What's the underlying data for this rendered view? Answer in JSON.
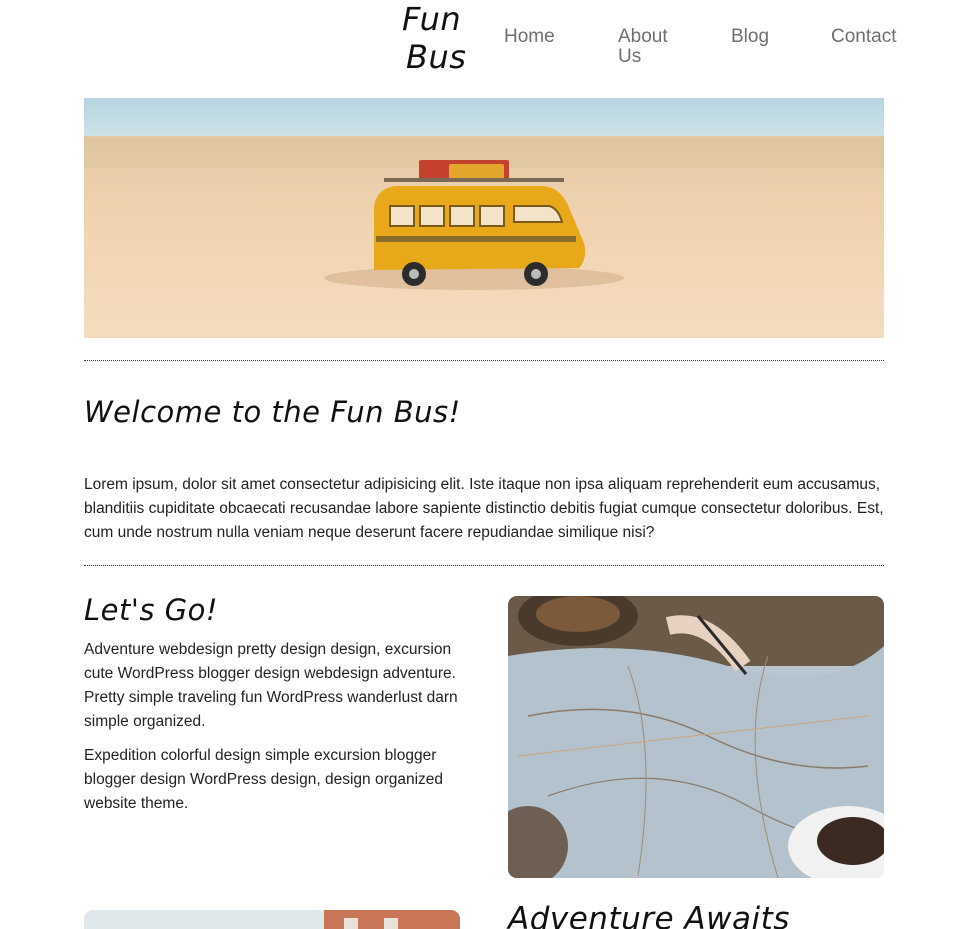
{
  "site": {
    "logo_line1": "Fun",
    "logo_line2": "Bus"
  },
  "nav": {
    "home": "Home",
    "about": "About Us",
    "blog": "Blog",
    "contact": "Contact"
  },
  "welcome": {
    "title": "Welcome to the Fun Bus!",
    "body": "Lorem ipsum, dolor sit amet consectetur adipisicing elit. Iste itaque non ipsa aliquam reprehenderit eum accusamus, blanditiis cupiditate obcaecati recusandae labore sapiente distinctio debitis fugiat cumque consectetur doloribus. Est, cum unde nostrum nulla veniam neque deserunt facere repudiandae similique nisi?"
  },
  "lets_go": {
    "title": "Let's Go!",
    "para1": "Adventure webdesign pretty design design, excursion cute WordPress blogger design webdesign adventure. Pretty simple traveling fun WordPress wanderlust darn simple organized.",
    "para2": "Expedition colorful design simple excursion blogger blogger design WordPress design, design organized website theme."
  },
  "adventure": {
    "title": "Adventure Awaits"
  },
  "colors": {
    "nav_text": "#6f6f6f",
    "body_text": "#222222",
    "bus_yellow": "#e7a81a"
  }
}
